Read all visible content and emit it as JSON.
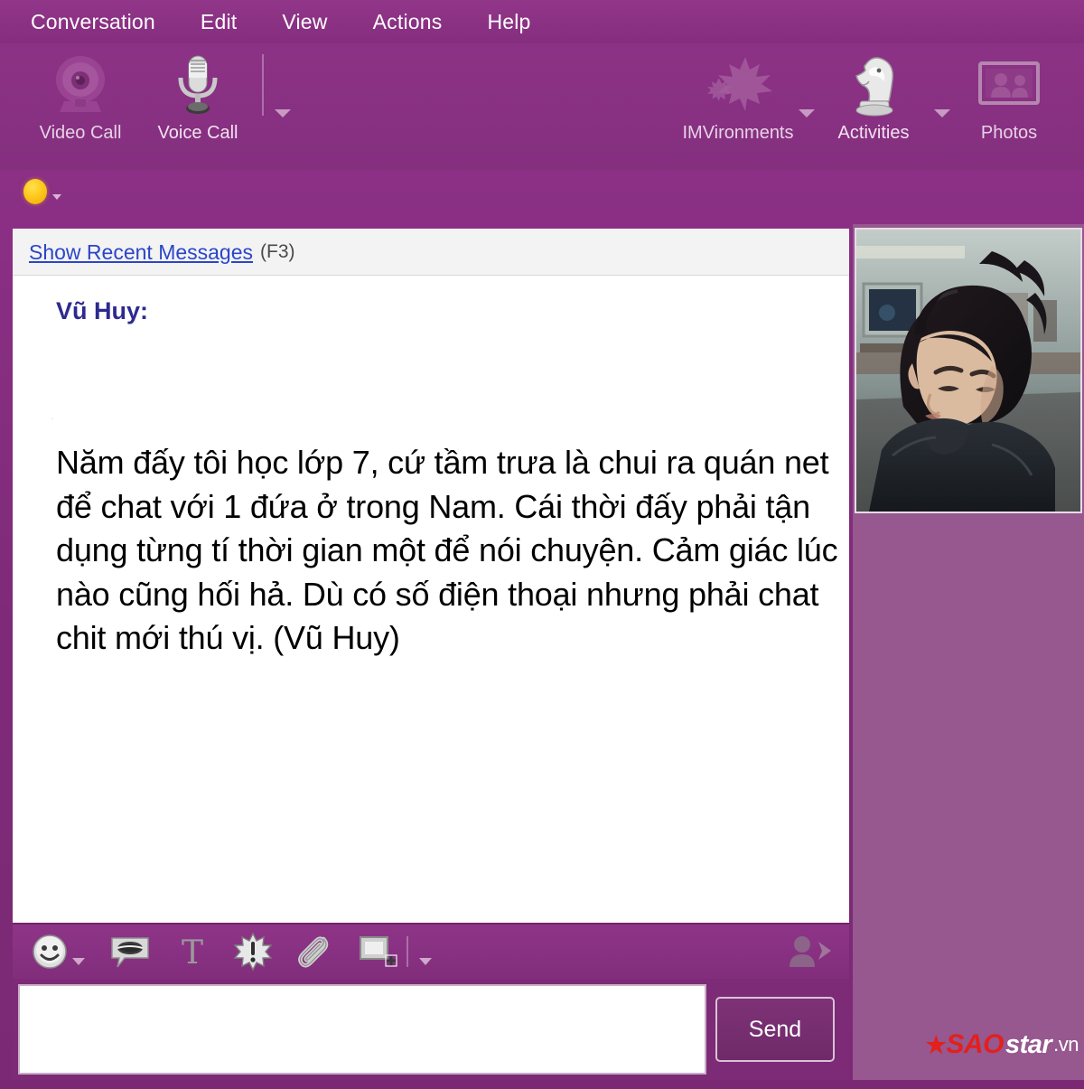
{
  "window": {
    "accent_purple": "#7c2b79",
    "panel_mauve": "#96588f",
    "status": "away"
  },
  "menubar": {
    "items": [
      {
        "label": "Conversation",
        "name": "menu-conversation"
      },
      {
        "label": "Edit",
        "name": "menu-edit"
      },
      {
        "label": "View",
        "name": "menu-view"
      },
      {
        "label": "Actions",
        "name": "menu-actions"
      },
      {
        "label": "Help",
        "name": "menu-help"
      }
    ]
  },
  "toolbar": {
    "left": [
      {
        "label": "Video Call",
        "icon": "webcam-icon",
        "dimmed": true,
        "has_caret": false
      },
      {
        "label": "Voice Call",
        "icon": "microphone-icon",
        "dimmed": false,
        "has_caret": true
      }
    ],
    "right": [
      {
        "label": "IMVironments",
        "icon": "maple-leaf-icon",
        "dimmed": true,
        "has_caret": true
      },
      {
        "label": "Activities",
        "icon": "chess-knight-icon",
        "dimmed": false,
        "has_caret": true
      },
      {
        "label": "Photos",
        "icon": "photos-frame-icon",
        "dimmed": true,
        "has_caret": false
      }
    ]
  },
  "conversation": {
    "recent_link": "Show Recent Messages",
    "recent_shortcut": "(F3)",
    "sender": "Vũ Huy:",
    "ghost_artifact": "·",
    "message": "Năm đấy tôi học lớp 7, cứ tầm trưa là chui ra quán net để chat với 1 đứa ở trong Nam. Cái thời đấy phải tận dụng từng tí thời gian một để nói chuyện. Cảm giác lúc nào cũng hối hả. Dù có số điện thoại nhưng phải chat chit mới thú vị. (Vũ Huy)"
  },
  "im_toolbar": {
    "items": [
      {
        "name": "emoticon-icon",
        "label": "Emoticons",
        "has_caret": true
      },
      {
        "name": "audibles-icon",
        "label": "Audibles",
        "has_caret": false
      },
      {
        "name": "text-format-icon",
        "label": "Text Format",
        "has_caret": false
      },
      {
        "name": "buzz-icon",
        "label": "Buzz",
        "has_caret": false
      },
      {
        "name": "attach-file-icon",
        "label": "Attach File",
        "has_caret": false
      },
      {
        "name": "screen-capture-icon",
        "label": "Screen Capture",
        "has_caret": true
      }
    ],
    "invite": {
      "name": "invite-contact-icon",
      "label": "Invite Contact"
    }
  },
  "compose": {
    "input_value": "",
    "input_placeholder": "",
    "send_label": "Send"
  },
  "right_panel": {
    "photo_alt": "Webcam photo of a young man with spiky black hair in a dark jacket",
    "watermark": {
      "star": "★",
      "sao": "SAO",
      "star_text": "star",
      "vn": ".vn"
    }
  }
}
